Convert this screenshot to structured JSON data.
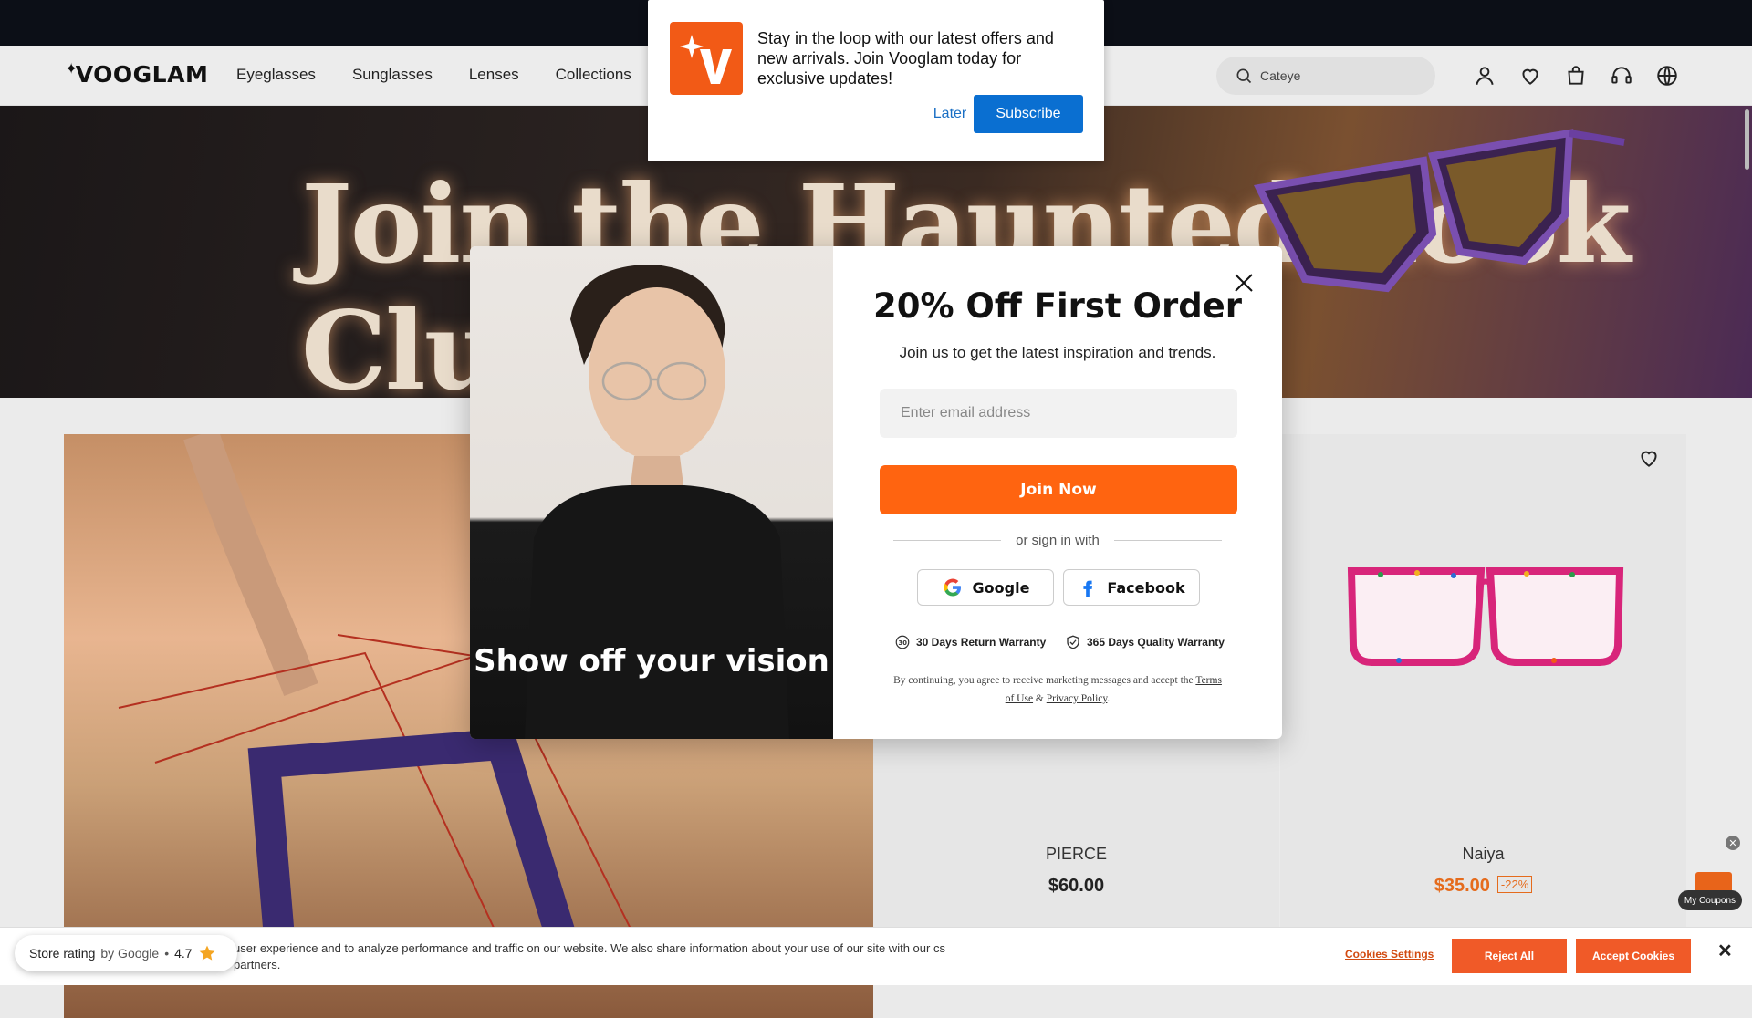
{
  "brand": {
    "logo_text": "VOOGLAM"
  },
  "nav": {
    "items": [
      "Eyeglasses",
      "Sunglasses",
      "Lenses",
      "Collections"
    ]
  },
  "search": {
    "value": "Cateye"
  },
  "hero": {
    "title": "Join the Haunted Look Club"
  },
  "notification": {
    "text": "Stay in the loop with our latest offers and new arrivals. Join Vooglam today for exclusive updates!",
    "later_label": "Later",
    "subscribe_label": "Subscribe"
  },
  "modal": {
    "image_caption": "Show off your vision",
    "title": "20% Off First Order",
    "subtitle": "Join us to get the latest inspiration and trends.",
    "email_placeholder": "Enter email address",
    "join_label": "Join Now",
    "or_text": "or sign in with",
    "google_label": "Google",
    "facebook_label": "Facebook",
    "warranty_1": "30 Days Return Warranty",
    "warranty_2": "365 Days Quality Warranty",
    "legal_prefix": "By continuing, you agree to receive marketing messages and accept the",
    "terms_label": "Terms of Use",
    "amp": "&",
    "privacy_label": "Privacy Policy",
    "period": "."
  },
  "products": [
    {
      "name": "PIERCE",
      "price": "$60.00"
    },
    {
      "name": "Naiya",
      "price": "$35.00",
      "discount": "-22%"
    }
  ],
  "cookie": {
    "text": "user experience and to analyze performance and traffic on our website. We also share information about your use of our site with our cs partners.",
    "settings_label": "Cookies Settings",
    "reject_label": "Reject All",
    "accept_label": "Accept Cookies",
    "close_label": "✕"
  },
  "rating": {
    "label": "Store rating",
    "by": "by Google",
    "sep": "•",
    "value": "4.7"
  },
  "coupons": {
    "label": "My Coupons"
  },
  "colors": {
    "accent": "#ff6410",
    "subscribe": "#0a6fd1",
    "sale": "#e56b1c"
  }
}
